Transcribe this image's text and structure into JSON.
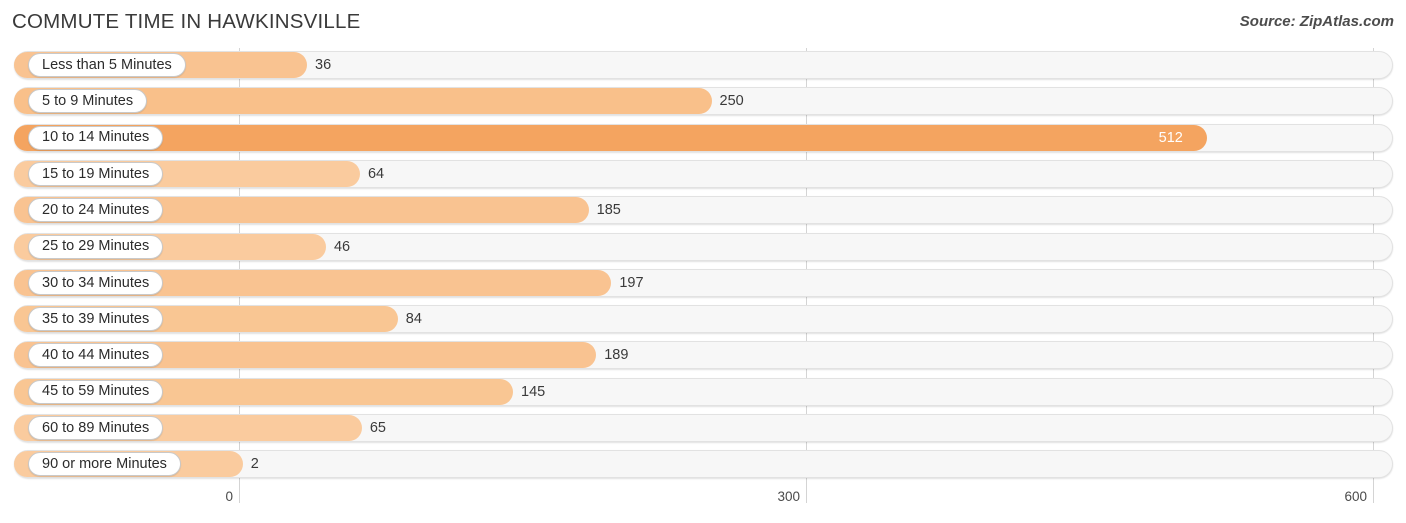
{
  "header": {
    "title": "COMMUTE TIME IN HAWKINSVILLE",
    "source": "Source: ZipAtlas.com"
  },
  "colors": {
    "bar_light": "#F9C391",
    "bar_mid": "#F8BC86",
    "bar_dark": "#F4A460",
    "track_fill": "#F7F7F7",
    "track_border": "#E2E2E2",
    "gridline": "#D4D4D4",
    "text": "#3A3A3A",
    "value_inside": "#FFFFFF"
  },
  "chart_data": {
    "type": "bar",
    "orientation": "horizontal",
    "title": "COMMUTE TIME IN HAWKINSVILLE",
    "xlabel": "",
    "ylabel": "",
    "xlim": [
      0,
      600
    ],
    "xticks": [
      0,
      300,
      600
    ],
    "xtick_labels": [
      "0",
      "300",
      "600"
    ],
    "grid": true,
    "legend": false,
    "categories": [
      "Less than 5 Minutes",
      "5 to 9 Minutes",
      "10 to 14 Minutes",
      "15 to 19 Minutes",
      "20 to 24 Minutes",
      "25 to 29 Minutes",
      "30 to 34 Minutes",
      "35 to 39 Minutes",
      "40 to 44 Minutes",
      "45 to 59 Minutes",
      "60 to 89 Minutes",
      "90 or more Minutes"
    ],
    "values": [
      36,
      250,
      512,
      64,
      185,
      46,
      197,
      84,
      189,
      145,
      65,
      2
    ],
    "value_labels": [
      "36",
      "250",
      "512",
      "64",
      "185",
      "46",
      "197",
      "84",
      "189",
      "145",
      "65",
      "2"
    ],
    "bars": [
      {
        "label": "Less than 5 Minutes",
        "value": 36,
        "value_label": "36",
        "color": "#F9C391",
        "label_inside": false
      },
      {
        "label": "5 to 9 Minutes",
        "value": 250,
        "value_label": "250",
        "color": "#F9C08A",
        "label_inside": false
      },
      {
        "label": "10 to 14 Minutes",
        "value": 512,
        "value_label": "512",
        "color": "#F4A460",
        "label_inside": true
      },
      {
        "label": "15 to 19 Minutes",
        "value": 64,
        "value_label": "64",
        "color": "#FACB9E",
        "label_inside": false
      },
      {
        "label": "20 to 24 Minutes",
        "value": 185,
        "value_label": "185",
        "color": "#F9C391",
        "label_inside": false
      },
      {
        "label": "25 to 29 Minutes",
        "value": 46,
        "value_label": "46",
        "color": "#FACB9E",
        "label_inside": false
      },
      {
        "label": "30 to 34 Minutes",
        "value": 197,
        "value_label": "197",
        "color": "#F9C391",
        "label_inside": false
      },
      {
        "label": "35 to 39 Minutes",
        "value": 84,
        "value_label": "84",
        "color": "#F9C693",
        "label_inside": false
      },
      {
        "label": "40 to 44 Minutes",
        "value": 189,
        "value_label": "189",
        "color": "#F9C391",
        "label_inside": false
      },
      {
        "label": "45 to 59 Minutes",
        "value": 145,
        "value_label": "145",
        "color": "#F9C693",
        "label_inside": false
      },
      {
        "label": "60 to 89 Minutes",
        "value": 65,
        "value_label": "65",
        "color": "#FACB9E",
        "label_inside": false
      },
      {
        "label": "90 or more Minutes",
        "value": 2,
        "value_label": "2",
        "color": "#FACB9E",
        "label_inside": false
      }
    ]
  }
}
